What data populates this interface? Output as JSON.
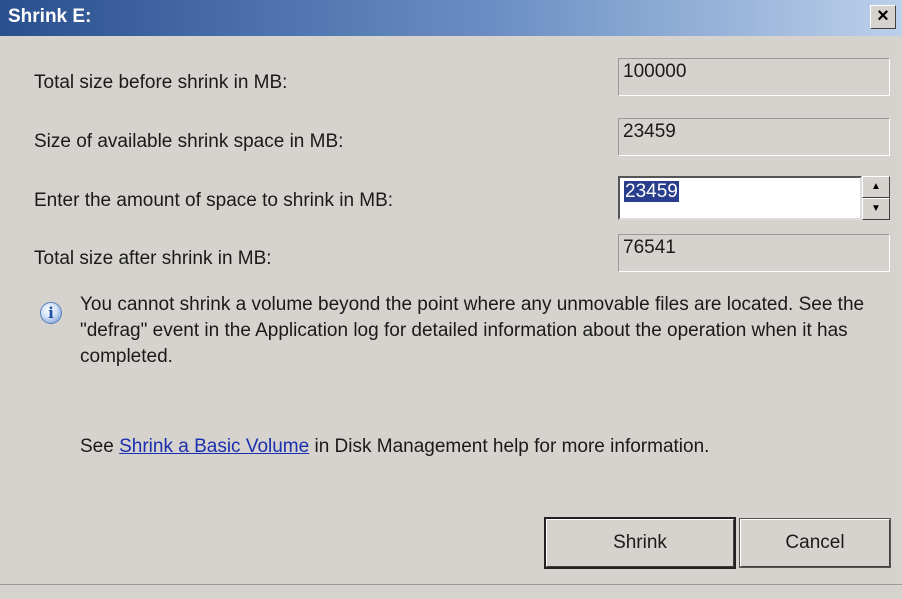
{
  "window": {
    "title": "Shrink E:",
    "close_label": "×"
  },
  "rows": [
    {
      "label": "Total size before shrink in MB:",
      "value": "100000"
    },
    {
      "label": "Size of available shrink space in MB:",
      "value": "23459"
    },
    {
      "label": "Enter the amount of space to shrink in MB:",
      "value": "23459"
    },
    {
      "label": "Total size after shrink in MB:",
      "value": "76541"
    }
  ],
  "info": {
    "icon": "info-icon",
    "text": "You cannot shrink a volume beyond the point where any unmovable files are located. See the \"defrag\" event in the Application log for detailed information about the operation when it has completed."
  },
  "help": {
    "prefix": "See ",
    "link_text": "Shrink a Basic Volume",
    "suffix": " in Disk Management help for more information."
  },
  "buttons": {
    "shrink": "Shrink",
    "cancel": "Cancel"
  }
}
